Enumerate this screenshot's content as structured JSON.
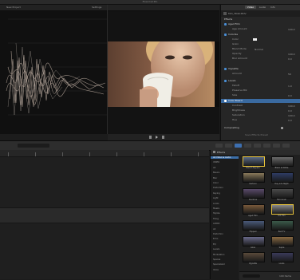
{
  "app": {
    "title": "Final Cut Pro"
  },
  "scope": {
    "title": "New Project",
    "setting": "Settings"
  },
  "inspector": {
    "tabs": [
      "Video",
      "Audio",
      "Info"
    ],
    "clip_name": "MVI_3849.MOV",
    "sections": {
      "effects": "Effects",
      "aged_film": "Aged Film",
      "colorize": "Colorize",
      "vignette": "Vignette",
      "levels": "Levels",
      "color_board": "Color Board",
      "compositing": "Compositing"
    },
    "rows": {
      "age_amount": "Age Amount",
      "color": "Color",
      "grain": "Grain",
      "blend_mode": "Blend Mode",
      "opacity": "Opacity",
      "size": "Size",
      "falloff": "Falloff",
      "blur_amount": "Blur Amount",
      "amount": "Amount",
      "grade": "Grade",
      "contrast": "Contrast",
      "brightness": "Brightness",
      "saturation": "Saturation",
      "hue": "Hue",
      "preserve_blacks": "Preserve Blk"
    },
    "values": {
      "v100": "100.0",
      "v0": "0.0",
      "v50": "50",
      "v1": "1.0",
      "normal": "Normal"
    },
    "save_preset": "Save Effects Preset"
  },
  "effects": {
    "header": "Effects",
    "categories": [
      "All Video & Audio",
      "VIDEO",
      "All",
      "Basics",
      "Blur",
      "Color",
      "Distortion",
      "Keying",
      "Light",
      "Looks",
      "Masks",
      "Stylize",
      "Tiling",
      "AUDIO",
      "All",
      "Distortion",
      "Echo",
      "EQ",
      "Levels",
      "Modulation",
      "Spaces",
      "Specialized",
      "Voice"
    ],
    "thumbs": [
      {
        "label": "Bleach Bypass",
        "c": "#5a6a86"
      },
      {
        "label": "Black & White",
        "c": "#6a6a6a"
      },
      {
        "label": "Cartoon",
        "c": "#8a7a5a"
      },
      {
        "label": "Day into Night",
        "c": "#2e3c64"
      },
      {
        "label": "Duotone",
        "c": "#5a4a6a"
      },
      {
        "label": "Film Grain",
        "c": "#4a4a4a"
      },
      {
        "label": "Aged Film",
        "c": "#7a5a3a"
      },
      {
        "label": "Old Film",
        "c": "#8a8a8a"
      },
      {
        "label": "Flipped",
        "c": "#4a5a7a"
      },
      {
        "label": "Bad TV",
        "c": "#3a5a4a"
      },
      {
        "label": "Glow",
        "c": "#6a6a8a"
      },
      {
        "label": "Sepia",
        "c": "#8a6a42"
      },
      {
        "label": "Vignette",
        "c": "#5a4a3a"
      },
      {
        "label": "Looks",
        "c": "#3a3a5a"
      }
    ],
    "footer_count": "190 Items"
  }
}
